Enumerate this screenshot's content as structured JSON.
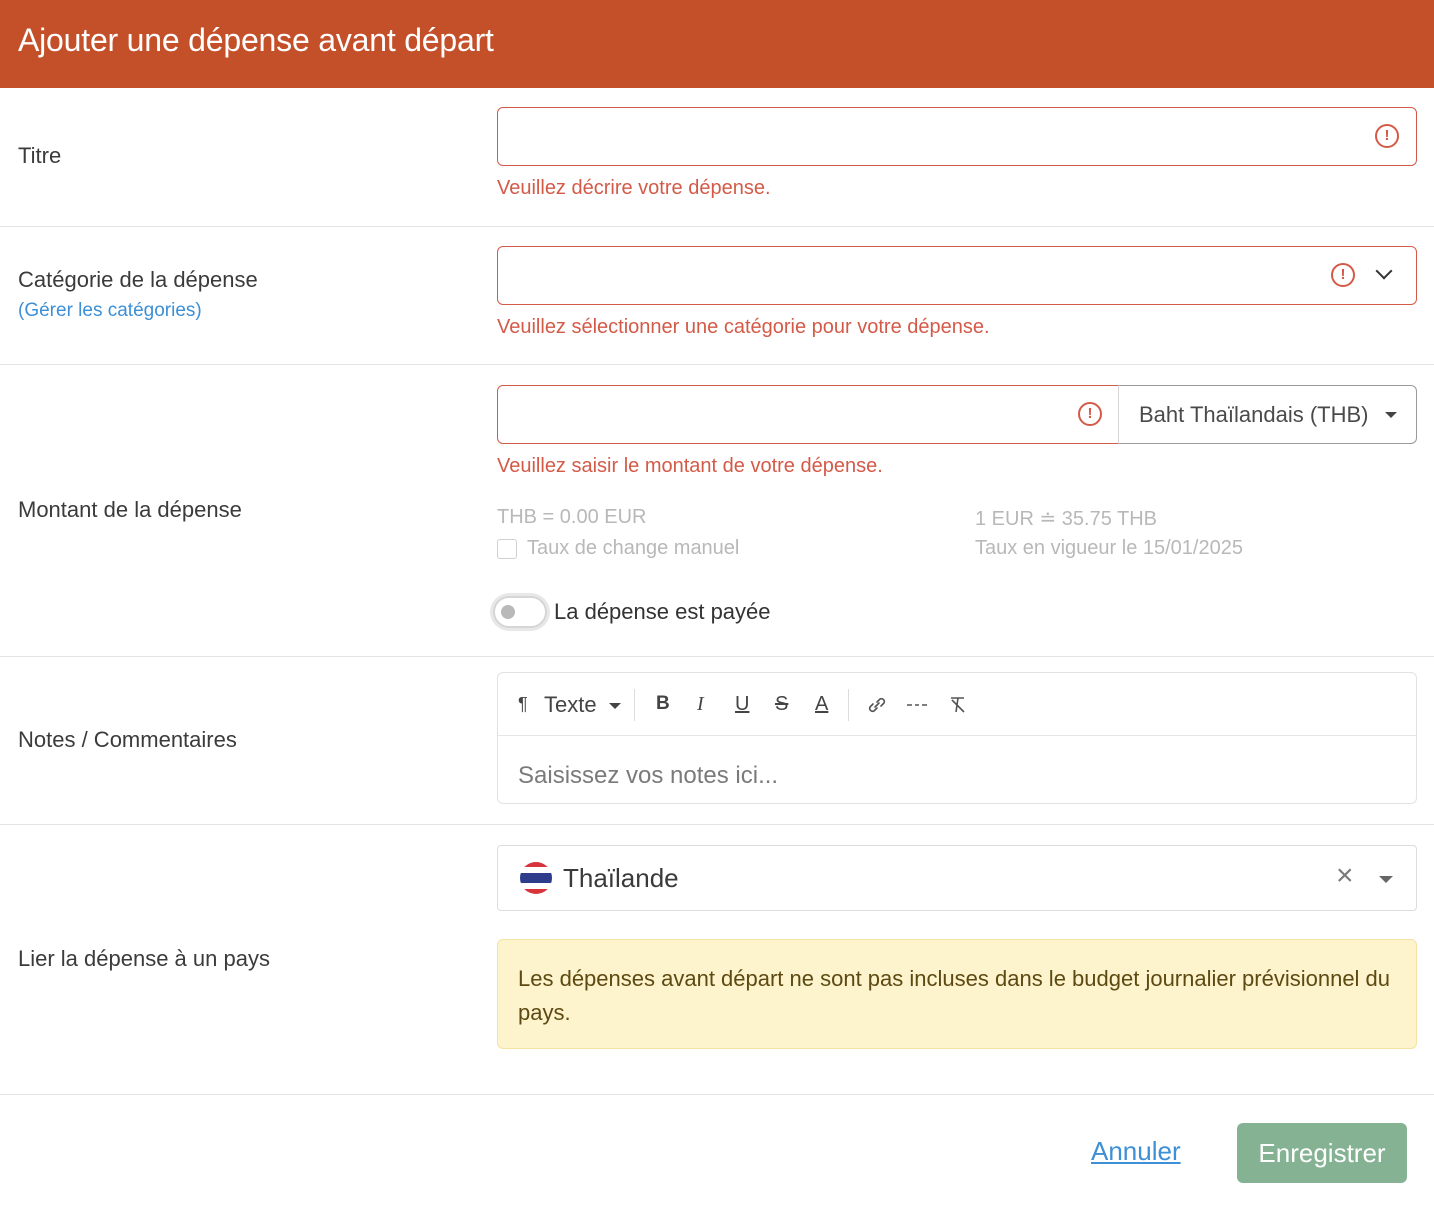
{
  "dialog": {
    "title": "Ajouter une dépense avant départ"
  },
  "titre": {
    "label": "Titre",
    "value": "",
    "error": "Veuillez décrire votre dépense."
  },
  "categorie": {
    "label": "Catégorie de la dépense",
    "manage_link": "(Gérer les catégories)",
    "value": "",
    "error": "Veuillez sélectionner une catégorie pour votre dépense."
  },
  "montant": {
    "label": "Montant de la dépense",
    "value": "",
    "currency": "Baht Thaïlandais (THB)",
    "error": "Veuillez saisir le montant de votre dépense.",
    "conversion": "THB = 0.00 EUR",
    "rate": "1 EUR ≐ 35.75 THB",
    "manual_rate_label": "Taux de change manuel",
    "manual_rate_checked": false,
    "rate_date": "Taux en vigueur le 15/01/2025",
    "paid_label": "La dépense est payée",
    "paid": false
  },
  "notes": {
    "label": "Notes / Commentaires",
    "format_label": "Texte",
    "placeholder": "Saisissez vos notes ici...",
    "toolbar": [
      "paragraph-icon",
      "bold-icon",
      "italic-icon",
      "underline-icon",
      "strikethrough-icon",
      "text-color-icon",
      "link-icon",
      "horizontal-rule-icon",
      "clear-format-icon"
    ]
  },
  "pays": {
    "label": "Lier la dépense à un pays",
    "selected": "Thaïlande",
    "info": "Les dépenses avant départ ne sont pas incluses dans le budget journalier prévisionnel du pays."
  },
  "footer": {
    "cancel": "Annuler",
    "save": "Enregistrer"
  },
  "colors": {
    "header": "#c4502a",
    "error": "#d45a48",
    "link": "#3d8fd6",
    "save": "#85b293",
    "alert_bg": "#fdf3cc"
  }
}
